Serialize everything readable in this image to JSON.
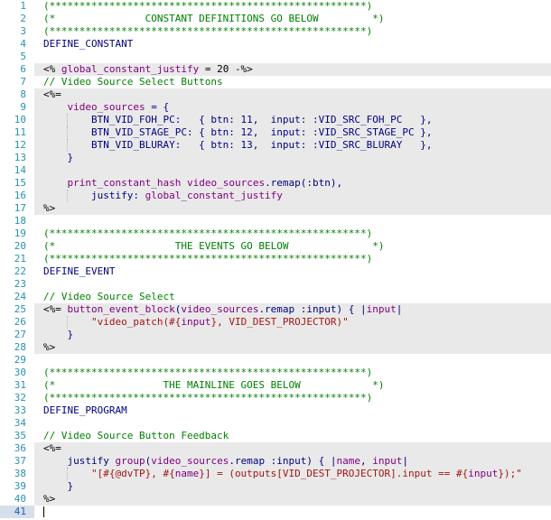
{
  "editor": {
    "colors": {
      "comment": "#008000",
      "define": "#000080",
      "erb_tag": "#000000",
      "ruby_var": "#800080",
      "ruby_text": "#000080",
      "string": "#a31515",
      "line_number": "#2b91af",
      "erb_background": "#e9e9e9"
    },
    "current_line": 41,
    "lines": [
      {
        "n": "1",
        "bg": false,
        "t": [
          [
            "(*****************************************************)",
            "comment"
          ]
        ]
      },
      {
        "n": "2",
        "bg": false,
        "t": [
          [
            "(*               CONSTANT DEFINITIONS GO BELOW         *)",
            "comment"
          ]
        ]
      },
      {
        "n": "3",
        "bg": false,
        "t": [
          [
            "(*****************************************************)",
            "comment"
          ]
        ]
      },
      {
        "n": "4",
        "bg": false,
        "t": [
          [
            "DEFINE_CONSTANT",
            "define"
          ]
        ]
      },
      {
        "n": "5",
        "bg": false,
        "t": []
      },
      {
        "n": "6",
        "bg": true,
        "t": [
          [
            "<% ",
            "erb"
          ],
          [
            "global_constant_justify",
            "var"
          ],
          [
            " = 20 -%>",
            "erb"
          ]
        ]
      },
      {
        "n": "7",
        "bg": false,
        "t": [
          [
            "// Video Source Select Buttons",
            "comment"
          ]
        ]
      },
      {
        "n": "8",
        "bg": true,
        "t": [
          [
            "<%=",
            "erb"
          ]
        ]
      },
      {
        "n": "9",
        "bg": true,
        "t": [
          [
            "    ",
            "plain"
          ],
          [
            "video_sources",
            "var"
          ],
          [
            " = {",
            "ruby"
          ]
        ]
      },
      {
        "n": "10",
        "bg": true,
        "t": [
          [
            "        BTN_VID_FOH_PC:   { btn: 11,  input: :VID_SRC_FOH_PC   },",
            "ruby"
          ]
        ]
      },
      {
        "n": "11",
        "bg": true,
        "t": [
          [
            "        BTN_VID_STAGE_PC: { btn: 12,  input: :VID_SRC_STAGE_PC },",
            "ruby"
          ]
        ]
      },
      {
        "n": "12",
        "bg": true,
        "t": [
          [
            "        BTN_VID_BLURAY:   { btn: 13,  input: :VID_SRC_BLURAY   },",
            "ruby"
          ]
        ]
      },
      {
        "n": "13",
        "bg": true,
        "t": [
          [
            "    }",
            "ruby"
          ]
        ]
      },
      {
        "n": "14",
        "bg": true,
        "t": []
      },
      {
        "n": "15",
        "bg": true,
        "t": [
          [
            "    ",
            "plain"
          ],
          [
            "print_constant_hash",
            "var"
          ],
          [
            " ",
            "plain"
          ],
          [
            "video_sources",
            "var"
          ],
          [
            ".remap(:btn),",
            "ruby"
          ]
        ]
      },
      {
        "n": "16",
        "bg": true,
        "t": [
          [
            "        justify: ",
            "ruby"
          ],
          [
            "global_constant_justify",
            "var"
          ]
        ]
      },
      {
        "n": "17",
        "bg": true,
        "t": [
          [
            "%>",
            "erb"
          ]
        ]
      },
      {
        "n": "18",
        "bg": false,
        "t": []
      },
      {
        "n": "19",
        "bg": false,
        "t": [
          [
            "(*****************************************************)",
            "comment"
          ]
        ]
      },
      {
        "n": "20",
        "bg": false,
        "t": [
          [
            "(*                    THE EVENTS GO BELOW              *)",
            "comment"
          ]
        ]
      },
      {
        "n": "21",
        "bg": false,
        "t": [
          [
            "(*****************************************************)",
            "comment"
          ]
        ]
      },
      {
        "n": "22",
        "bg": false,
        "t": [
          [
            "DEFINE_EVENT",
            "define"
          ]
        ]
      },
      {
        "n": "23",
        "bg": false,
        "t": []
      },
      {
        "n": "24",
        "bg": false,
        "t": [
          [
            "// Video Source Select",
            "comment"
          ]
        ]
      },
      {
        "n": "25",
        "bg": true,
        "t": [
          [
            "<%= ",
            "erb"
          ],
          [
            "button_event_block",
            "var"
          ],
          [
            "(",
            "ruby"
          ],
          [
            "video_sources",
            "var"
          ],
          [
            ".remap :input) { |",
            "ruby"
          ],
          [
            "input",
            "var"
          ],
          [
            "|",
            "ruby"
          ]
        ]
      },
      {
        "n": "26",
        "bg": true,
        "t": [
          [
            "        \"video_patch(#{",
            "string"
          ],
          [
            "input",
            "var"
          ],
          [
            "}, VID_DEST_PROJECTOR)\"",
            "string"
          ]
        ]
      },
      {
        "n": "27",
        "bg": true,
        "t": [
          [
            "    }",
            "ruby"
          ]
        ]
      },
      {
        "n": "28",
        "bg": true,
        "t": [
          [
            "%>",
            "erb"
          ]
        ]
      },
      {
        "n": "29",
        "bg": false,
        "t": []
      },
      {
        "n": "30",
        "bg": false,
        "t": [
          [
            "(*****************************************************)",
            "comment"
          ]
        ]
      },
      {
        "n": "31",
        "bg": false,
        "t": [
          [
            "(*                  THE MAINLINE GOES BELOW            *)",
            "comment"
          ]
        ]
      },
      {
        "n": "32",
        "bg": false,
        "t": [
          [
            "(*****************************************************)",
            "comment"
          ]
        ]
      },
      {
        "n": "33",
        "bg": false,
        "t": [
          [
            "DEFINE_PROGRAM",
            "define"
          ]
        ]
      },
      {
        "n": "34",
        "bg": false,
        "t": []
      },
      {
        "n": "35",
        "bg": false,
        "t": [
          [
            "// Video Source Button Feedback",
            "comment"
          ]
        ]
      },
      {
        "n": "36",
        "bg": true,
        "t": [
          [
            "<%=",
            "erb"
          ]
        ]
      },
      {
        "n": "37",
        "bg": true,
        "t": [
          [
            "    justify ",
            "ruby"
          ],
          [
            "group",
            "var"
          ],
          [
            "(",
            "ruby"
          ],
          [
            "video_sources",
            "var"
          ],
          [
            ".remap :input) { |",
            "ruby"
          ],
          [
            "name",
            "var"
          ],
          [
            ", ",
            "ruby"
          ],
          [
            "input",
            "var"
          ],
          [
            "|",
            "ruby"
          ]
        ]
      },
      {
        "n": "38",
        "bg": true,
        "t": [
          [
            "        \"[#{@dvTP}, #{",
            "string"
          ],
          [
            "name",
            "var"
          ],
          [
            "}] = (outputs[VID_DEST_PROJECTOR].input == #{",
            "string"
          ],
          [
            "input",
            "var"
          ],
          [
            "});\"",
            "string"
          ]
        ]
      },
      {
        "n": "39",
        "bg": true,
        "t": [
          [
            "    }",
            "ruby"
          ]
        ]
      },
      {
        "n": "40",
        "bg": true,
        "t": [
          [
            "%>",
            "erb"
          ]
        ]
      },
      {
        "n": "41",
        "bg": false,
        "t": []
      }
    ]
  }
}
